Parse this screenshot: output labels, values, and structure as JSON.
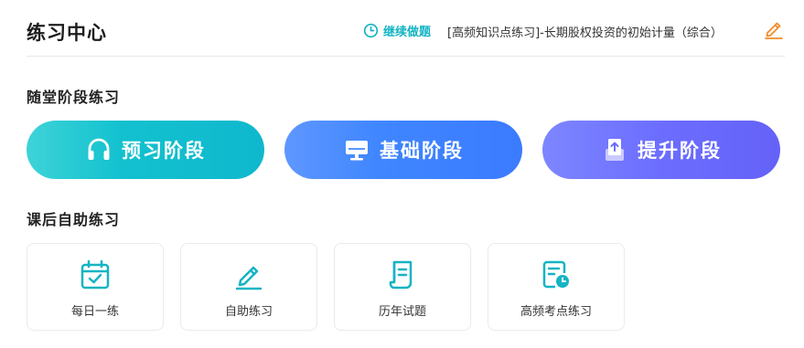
{
  "header": {
    "title": "练习中心",
    "continue_label": "继续做题",
    "last_exercise": "[高频知识点练习]-长期股权投资的初始计量（综合）"
  },
  "in_class": {
    "title": "随堂阶段练习",
    "stages": [
      {
        "label": "预习阶段",
        "icon": "headphones-icon"
      },
      {
        "label": "基础阶段",
        "icon": "monitor-icon"
      },
      {
        "label": "提升阶段",
        "icon": "upload-box-icon"
      }
    ]
  },
  "after_class": {
    "title": "课后自助练习",
    "tools": [
      {
        "label": "每日一练",
        "icon": "calendar-check-icon"
      },
      {
        "label": "自助练习",
        "icon": "pencil-icon"
      },
      {
        "label": "历年试题",
        "icon": "scroll-document-icon"
      },
      {
        "label": "高频考点练习",
        "icon": "document-clock-icon"
      }
    ]
  },
  "colors": {
    "accent_teal": "#14b4c4",
    "edit_orange": "#f28c28",
    "stage_1": "#12c1cf",
    "stage_2": "#3f86ff",
    "stage_3": "#6c6dff"
  }
}
